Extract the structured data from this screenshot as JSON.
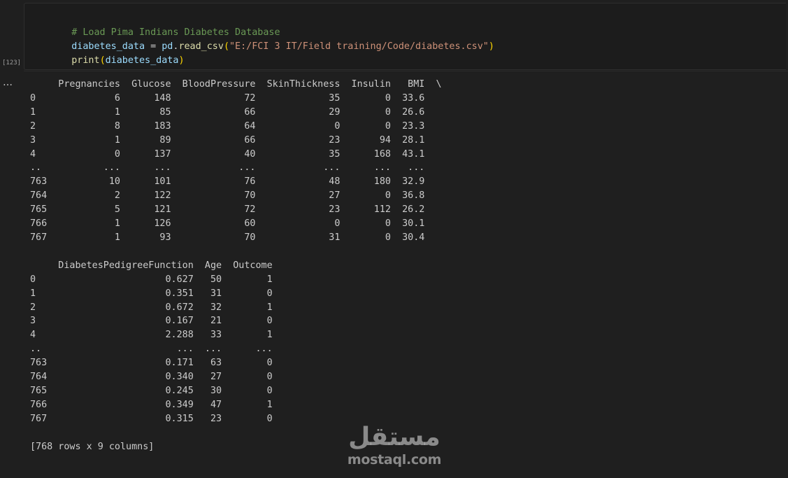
{
  "code_cell": {
    "execution_count": "[123]",
    "comment": "# Load Pima Indians Diabetes Database",
    "line2": {
      "var": "diabetes_data",
      "op": " = ",
      "obj": "pd",
      "dot": ".",
      "fn": "read_csv",
      "open": "(",
      "str": "\"E:/FCI 3 IT/Field training/Code/diabetes.csv\"",
      "close": ")"
    },
    "line3": {
      "fn": "print",
      "open": "(",
      "arg": "diabetes_data",
      "close": ")"
    }
  },
  "output": {
    "menu_icon": "ellipsis-icon",
    "menu_label": "…",
    "text": "     Pregnancies  Glucose  BloodPressure  SkinThickness  Insulin   BMI  \\\n0              6      148             72             35        0  33.6   \n1              1       85             66             29        0  26.6   \n2              8      183             64              0        0  23.3   \n3              1       89             66             23       94  28.1   \n4              0      137             40             35      168  43.1   \n..           ...      ...            ...            ...      ...   ...   \n763           10      101             76             48      180  32.9   \n764            2      122             70             27        0  36.8   \n765            5      121             72             23      112  26.2   \n766            1      126             60              0        0  30.1   \n767            1       93             70             31        0  30.4   \n\n     DiabetesPedigreeFunction  Age  Outcome  \n0                       0.627   50        1  \n1                       0.351   31        0  \n2                       0.672   32        1  \n3                       0.167   21        0  \n4                       2.288   33        1  \n..                        ...  ...      ...  \n763                     0.171   63        0  \n764                     0.340   27        0  \n765                     0.245   30        0  \n766                     0.349   47        1  \n767                     0.315   23        0  \n\n[768 rows x 9 columns]"
  },
  "watermark": {
    "arabic": "مستقل",
    "latin": "mostaql.com"
  }
}
